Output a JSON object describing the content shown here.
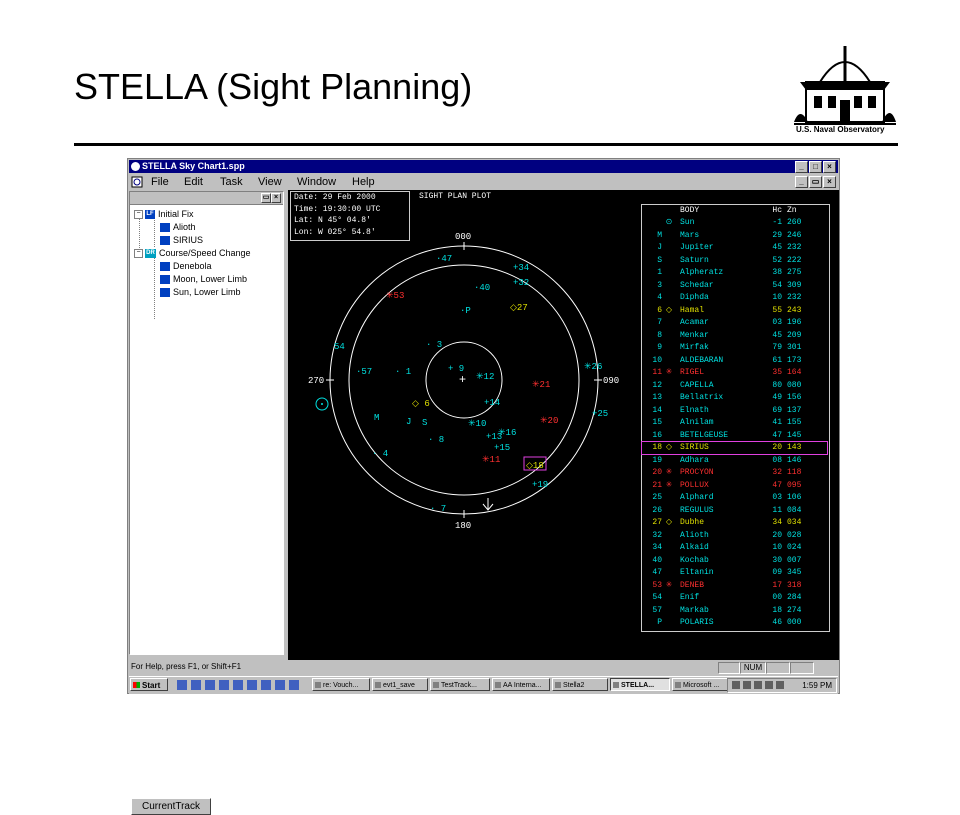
{
  "slide": {
    "title": "STELLA (Sight Planning)",
    "logo_caption": "U.S. Naval Observatory"
  },
  "window": {
    "title": "STELLA Sky Chart1.spp",
    "menu": [
      "File",
      "Edit",
      "Task",
      "View",
      "Window",
      "Help"
    ]
  },
  "tree": {
    "nodes": [
      {
        "label": "Initial Fix",
        "icon": "lf-icon",
        "toggle": "−",
        "level": 0
      },
      {
        "label": "Alioth",
        "icon": "star-sight-icon",
        "level": 1
      },
      {
        "label": "SIRIUS",
        "icon": "star-sight-icon",
        "level": 1
      },
      {
        "label": "Course/Speed Change",
        "icon": "dr-icon",
        "toggle": "−",
        "level": 0
      },
      {
        "label": "Denebola",
        "icon": "star-sight-icon",
        "level": 1
      },
      {
        "label": "Moon, Lower Limb",
        "icon": "star-sight-icon",
        "level": 1
      },
      {
        "label": "Sun, Lower Limb",
        "icon": "star-sight-icon",
        "level": 1
      }
    ],
    "tab_label": "CurrentTrack"
  },
  "infobox": {
    "date": "Date: 29 Feb 2000",
    "time": "Time: 19:30:00 UTC",
    "lat": "Lat:  N  45° 04.8'",
    "lon": "Lon:  W 025° 54.8'"
  },
  "plot_title": "SIGHT PLAN PLOT",
  "compass": {
    "north": "000",
    "east": "090",
    "south": "180",
    "west": "270"
  },
  "plot_markers": [
    {
      "label": "·47",
      "color": "#00e0e0"
    },
    {
      "label": "+34",
      "color": "#00e0e0"
    },
    {
      "label": "+32",
      "color": "#00e0e0"
    },
    {
      "label": "·40",
      "color": "#00e0e0"
    },
    {
      "label": "·P",
      "color": "#00e0e0"
    },
    {
      "label": "◇27",
      "color": "#e0e000"
    },
    {
      "label": "✳53",
      "color": "#ff3030"
    },
    {
      "label": "54",
      "color": "#00e0e0"
    },
    {
      "label": "· 3",
      "color": "#00e0e0"
    },
    {
      "label": "+ 9",
      "color": "#00e0e0"
    },
    {
      "label": "✳12",
      "color": "#00e0e0"
    },
    {
      "label": "·57",
      "color": "#00e0e0"
    },
    {
      "label": "· 1",
      "color": "#00e0e0"
    },
    {
      "label": "✳21",
      "color": "#ff3030"
    },
    {
      "label": "✳26",
      "color": "#00e0e0"
    },
    {
      "label": "◇ 6",
      "color": "#e0e000"
    },
    {
      "label": "+14",
      "color": "#00e0e0"
    },
    {
      "label": "M",
      "color": "#00e0e0"
    },
    {
      "label": "J",
      "color": "#00e0e0"
    },
    {
      "label": "S",
      "color": "#00e0e0"
    },
    {
      "label": "✳10",
      "color": "#00e0e0"
    },
    {
      "label": "✳20",
      "color": "#ff3030"
    },
    {
      "label": "+25",
      "color": "#00e0e0"
    },
    {
      "label": "· 8",
      "color": "#00e0e0"
    },
    {
      "label": "+13",
      "color": "#00e0e0"
    },
    {
      "label": "✳16",
      "color": "#00e0e0"
    },
    {
      "label": "+15",
      "color": "#00e0e0"
    },
    {
      "label": "· 4",
      "color": "#00e0e0"
    },
    {
      "label": "✳11",
      "color": "#ff3030"
    },
    {
      "label": "◇18",
      "color": "#e0e000"
    },
    {
      "label": "+19",
      "color": "#00e0e0"
    },
    {
      "label": "· 7",
      "color": "#00e0e0"
    }
  ],
  "body_table": {
    "header": {
      "body": "BODY",
      "hc": "Hc",
      "zn": "Zn"
    },
    "rows": [
      {
        "num": "",
        "sym": "⊙",
        "name": "Sun",
        "hc": "-1",
        "zn": "260",
        "color": "#00e0e0"
      },
      {
        "num": "M",
        "sym": "",
        "name": "Mars",
        "hc": "29",
        "zn": "246",
        "color": "#00e0e0"
      },
      {
        "num": "J",
        "sym": "",
        "name": "Jupiter",
        "hc": "45",
        "zn": "232",
        "color": "#00e0e0"
      },
      {
        "num": "S",
        "sym": "",
        "name": "Saturn",
        "hc": "52",
        "zn": "222",
        "color": "#00e0e0"
      },
      {
        "num": "1",
        "sym": "",
        "name": "Alpheratz",
        "hc": "38",
        "zn": "275",
        "color": "#00e0e0"
      },
      {
        "num": "3",
        "sym": "",
        "name": "Schedar",
        "hc": "54",
        "zn": "309",
        "color": "#00e0e0"
      },
      {
        "num": "4",
        "sym": "",
        "name": "Diphda",
        "hc": "10",
        "zn": "232",
        "color": "#00e0e0"
      },
      {
        "num": "6",
        "sym": "◇",
        "name": "Hamal",
        "hc": "55",
        "zn": "243",
        "color": "#e0e000"
      },
      {
        "num": "7",
        "sym": "",
        "name": "Acamar",
        "hc": "03",
        "zn": "196",
        "color": "#00e0e0"
      },
      {
        "num": "8",
        "sym": "",
        "name": "Menkar",
        "hc": "45",
        "zn": "209",
        "color": "#00e0e0"
      },
      {
        "num": "9",
        "sym": "",
        "name": "Mirfak",
        "hc": "79",
        "zn": "301",
        "color": "#00e0e0"
      },
      {
        "num": "10",
        "sym": "",
        "name": "ALDEBARAN",
        "hc": "61",
        "zn": "173",
        "color": "#00e0e0"
      },
      {
        "num": "11",
        "sym": "✳",
        "name": "RIGEL",
        "hc": "35",
        "zn": "164",
        "color": "#ff3030"
      },
      {
        "num": "12",
        "sym": "",
        "name": "CAPELLA",
        "hc": "80",
        "zn": "080",
        "color": "#00e0e0"
      },
      {
        "num": "13",
        "sym": "",
        "name": "Bellatrix",
        "hc": "49",
        "zn": "156",
        "color": "#00e0e0"
      },
      {
        "num": "14",
        "sym": "",
        "name": "Elnath",
        "hc": "69",
        "zn": "137",
        "color": "#00e0e0"
      },
      {
        "num": "15",
        "sym": "",
        "name": "Alnilam",
        "hc": "41",
        "zn": "155",
        "color": "#00e0e0"
      },
      {
        "num": "16",
        "sym": "",
        "name": "BETELGEUSE",
        "hc": "47",
        "zn": "145",
        "color": "#00e0e0"
      },
      {
        "num": "18",
        "sym": "◇",
        "name": "SIRIUS",
        "hc": "20",
        "zn": "143",
        "color": "#e0e000",
        "selected": true
      },
      {
        "num": "19",
        "sym": "",
        "name": "Adhara",
        "hc": "08",
        "zn": "146",
        "color": "#00e0e0"
      },
      {
        "num": "20",
        "sym": "✳",
        "name": "PROCYON",
        "hc": "32",
        "zn": "118",
        "color": "#ff3030"
      },
      {
        "num": "21",
        "sym": "✳",
        "name": "POLLUX",
        "hc": "47",
        "zn": "095",
        "color": "#ff3030"
      },
      {
        "num": "25",
        "sym": "",
        "name": "Alphard",
        "hc": "03",
        "zn": "106",
        "color": "#00e0e0"
      },
      {
        "num": "26",
        "sym": "",
        "name": "REGULUS",
        "hc": "11",
        "zn": "084",
        "color": "#00e0e0"
      },
      {
        "num": "27",
        "sym": "◇",
        "name": "Dubhe",
        "hc": "34",
        "zn": "034",
        "color": "#e0e000"
      },
      {
        "num": "32",
        "sym": "",
        "name": "Alioth",
        "hc": "20",
        "zn": "028",
        "color": "#00e0e0"
      },
      {
        "num": "34",
        "sym": "",
        "name": "Alkaid",
        "hc": "10",
        "zn": "024",
        "color": "#00e0e0"
      },
      {
        "num": "40",
        "sym": "",
        "name": "Kochab",
        "hc": "30",
        "zn": "007",
        "color": "#00e0e0"
      },
      {
        "num": "47",
        "sym": "",
        "name": "Eltanin",
        "hc": "09",
        "zn": "345",
        "color": "#00e0e0"
      },
      {
        "num": "53",
        "sym": "✳",
        "name": "DENEB",
        "hc": "17",
        "zn": "318",
        "color": "#ff3030"
      },
      {
        "num": "54",
        "sym": "",
        "name": "Enif",
        "hc": "00",
        "zn": "284",
        "color": "#00e0e0"
      },
      {
        "num": "57",
        "sym": "",
        "name": "Markab",
        "hc": "18",
        "zn": "274",
        "color": "#00e0e0"
      },
      {
        "num": "P",
        "sym": "",
        "name": "POLARIS",
        "hc": "46",
        "zn": "000",
        "color": "#00e0e0"
      }
    ]
  },
  "statusbar": {
    "help": "For Help, press F1, or Shift+F1",
    "num": "NUM"
  },
  "taskbar": {
    "start": "Start",
    "buttons": [
      "re: Vouch...",
      "evt1_save",
      "TestTrack...",
      "AA Interna...",
      "Stella2",
      "STELLA...",
      "Microsoft ..."
    ],
    "active_index": 5,
    "clock": "1:59 PM"
  }
}
